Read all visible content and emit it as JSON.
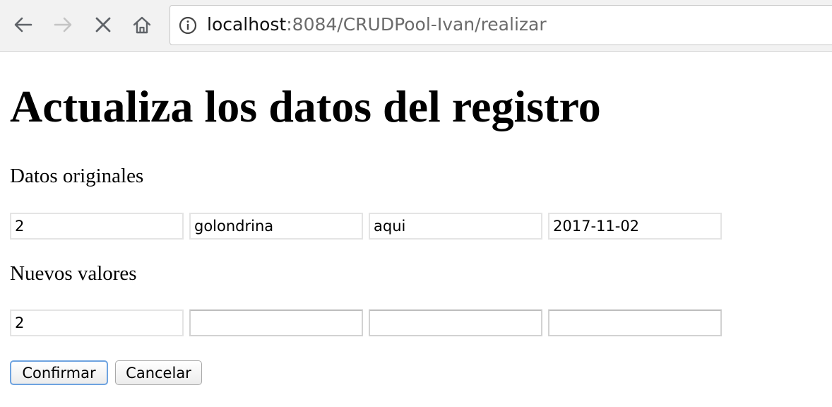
{
  "browser": {
    "url_host": "localhost",
    "url_rest": ":8084/CRUDPool-Ivan/realizar",
    "icons": {
      "back": "back-arrow-icon",
      "forward": "forward-arrow-icon",
      "stop": "stop-icon",
      "home": "home-icon",
      "info": "info-icon"
    }
  },
  "page": {
    "title": "Actualiza los datos del registro",
    "original_label": "Datos originales",
    "new_label": "Nuevos valores",
    "original_values": [
      "2",
      "golondrina",
      "aqui",
      "2017-11-02"
    ],
    "new_values": [
      "2",
      "",
      "",
      ""
    ],
    "confirm_label": "Confirmar",
    "cancel_label": "Cancelar"
  }
}
